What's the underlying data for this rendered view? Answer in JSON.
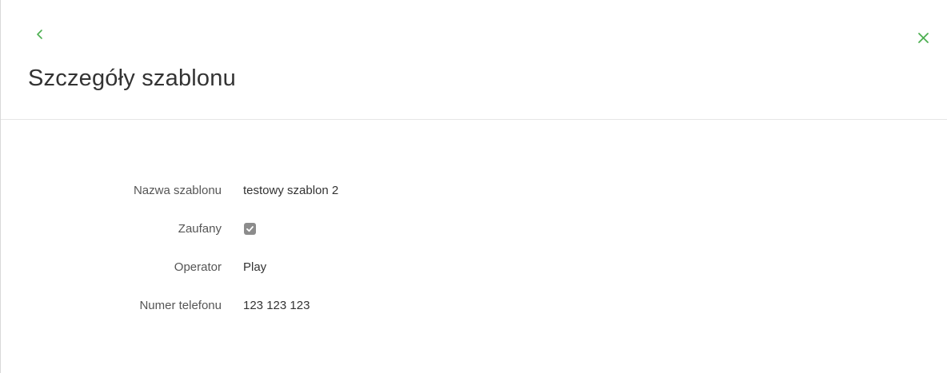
{
  "header": {
    "back_icon": "chevron-left-icon",
    "close_icon": "close-icon",
    "title": "Szczegóły szablonu",
    "accent_color": "#4caf50"
  },
  "details": {
    "rows": [
      {
        "label": "Nazwa szablonu",
        "value": "testowy szablon 2"
      },
      {
        "label": "Zaufany",
        "checked": true
      },
      {
        "label": "Operator",
        "value": "Play"
      },
      {
        "label": "Numer telefonu",
        "value": "123 123 123"
      }
    ]
  }
}
